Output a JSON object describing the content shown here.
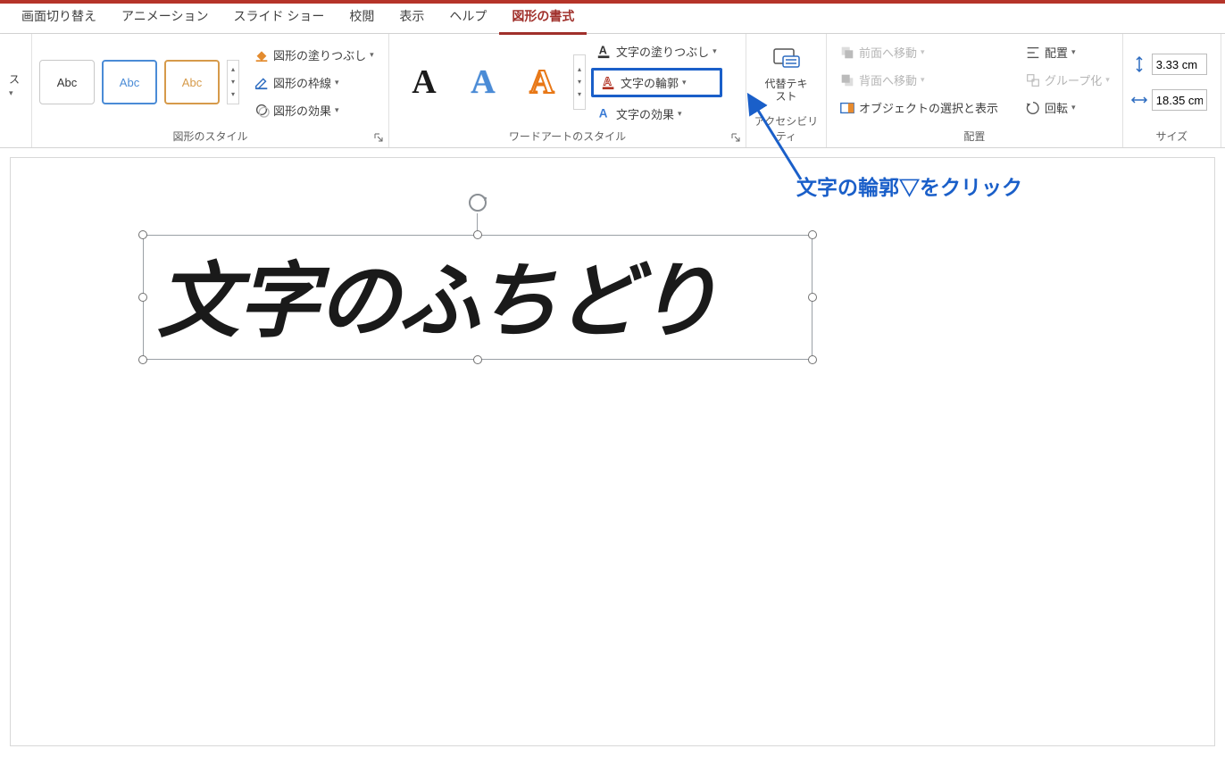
{
  "tabs": {
    "transitions": "画面切り替え",
    "animations": "アニメーション",
    "slideshow": "スライド ショー",
    "review": "校閲",
    "view": "表示",
    "help": "ヘルプ",
    "shape_format": "図形の書式"
  },
  "truncated_tab_fragment": "ス",
  "ribbon": {
    "shape_styles_label": "図形のスタイル",
    "thumb_text": "Abc",
    "shape_fill": "図形の塗りつぶし",
    "shape_outline": "図形の枠線",
    "shape_effects": "図形の効果",
    "wordart_styles_label": "ワードアートのスタイル",
    "wa_letter": "A",
    "text_fill": "文字の塗りつぶし",
    "text_outline": "文字の輪郭",
    "text_effects": "文字の効果",
    "accessibility_label": "アクセシビリティ",
    "alt_text": "代替テキスト",
    "arrange_label": "配置",
    "bring_forward": "前面へ移動",
    "send_backward": "背面へ移動",
    "selection_pane": "オブジェクトの選択と表示",
    "align": "配置",
    "group": "グループ化",
    "rotate": "回転",
    "size_label": "サイズ",
    "height_value": "3.33 cm",
    "width_value": "18.35 cm"
  },
  "slide": {
    "textbox_content": "文字のふちどり"
  },
  "annotation": {
    "text": "文字の輪郭▽をクリック"
  }
}
